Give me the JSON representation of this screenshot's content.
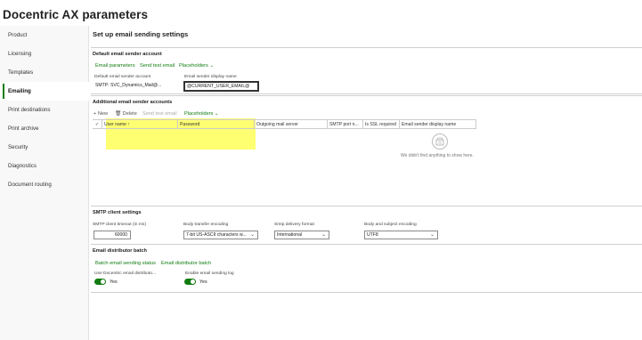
{
  "app": {
    "title": "Docentric AX parameters"
  },
  "sidebar": {
    "items": [
      {
        "label": "Product"
      },
      {
        "label": "Licensing"
      },
      {
        "label": "Templates"
      },
      {
        "label": "Emailing",
        "active": true
      },
      {
        "label": "Print destinations"
      },
      {
        "label": "Print archive"
      },
      {
        "label": "Security"
      },
      {
        "label": "Diagnostics"
      },
      {
        "label": "Document routing"
      }
    ]
  },
  "main": {
    "heading": "Set up email sending settings",
    "default_sender": {
      "title": "Default email sender account",
      "links": {
        "email_parameters": "Email parameters",
        "send_test_email": "Send test email",
        "placeholders": "Placeholders"
      },
      "account_label": "Default email sender account",
      "account_value": "SMTP: SVC_Dynamics_Mail@...",
      "display_name_label": "Email sender display name",
      "display_name_value": "@CURRENT_USER_EMAIL@"
    },
    "additional": {
      "title": "Additional email sender accounts",
      "toolbar": {
        "new": "New",
        "delete": "Delete",
        "send_test": "Send test email",
        "placeholders": "Placeholders"
      },
      "columns": [
        "User name ↑",
        "Password",
        "Outgoing mail server",
        "SMTP port n...",
        "Is SSL required",
        "Email sender display name"
      ],
      "empty_text": "We didn't find anything to show here."
    },
    "smtp": {
      "title": "SMTP client settings",
      "timeout_label": "SMTP client timeout (in ms)",
      "timeout_value": "60000",
      "body_encoding_label": "Body transfer encoding",
      "body_encoding_value": "7-bit US-ASCII characters w...",
      "delivery_label": "Smtp delivery format",
      "delivery_value": "International",
      "subject_encoding_label": "Body and subject encoding",
      "subject_encoding_value": "UTF8"
    },
    "batch": {
      "title": "Email distributor batch",
      "links": {
        "status": "Batch email sending status",
        "distributor": "Email distributor batch"
      },
      "use_label": "Use Docentric email distributo...",
      "use_value": "Yes",
      "log_label": "Enable email sending log",
      "log_value": "Yes"
    }
  },
  "colors": {
    "accent": "#107c10",
    "highlight": "#ffff59"
  }
}
